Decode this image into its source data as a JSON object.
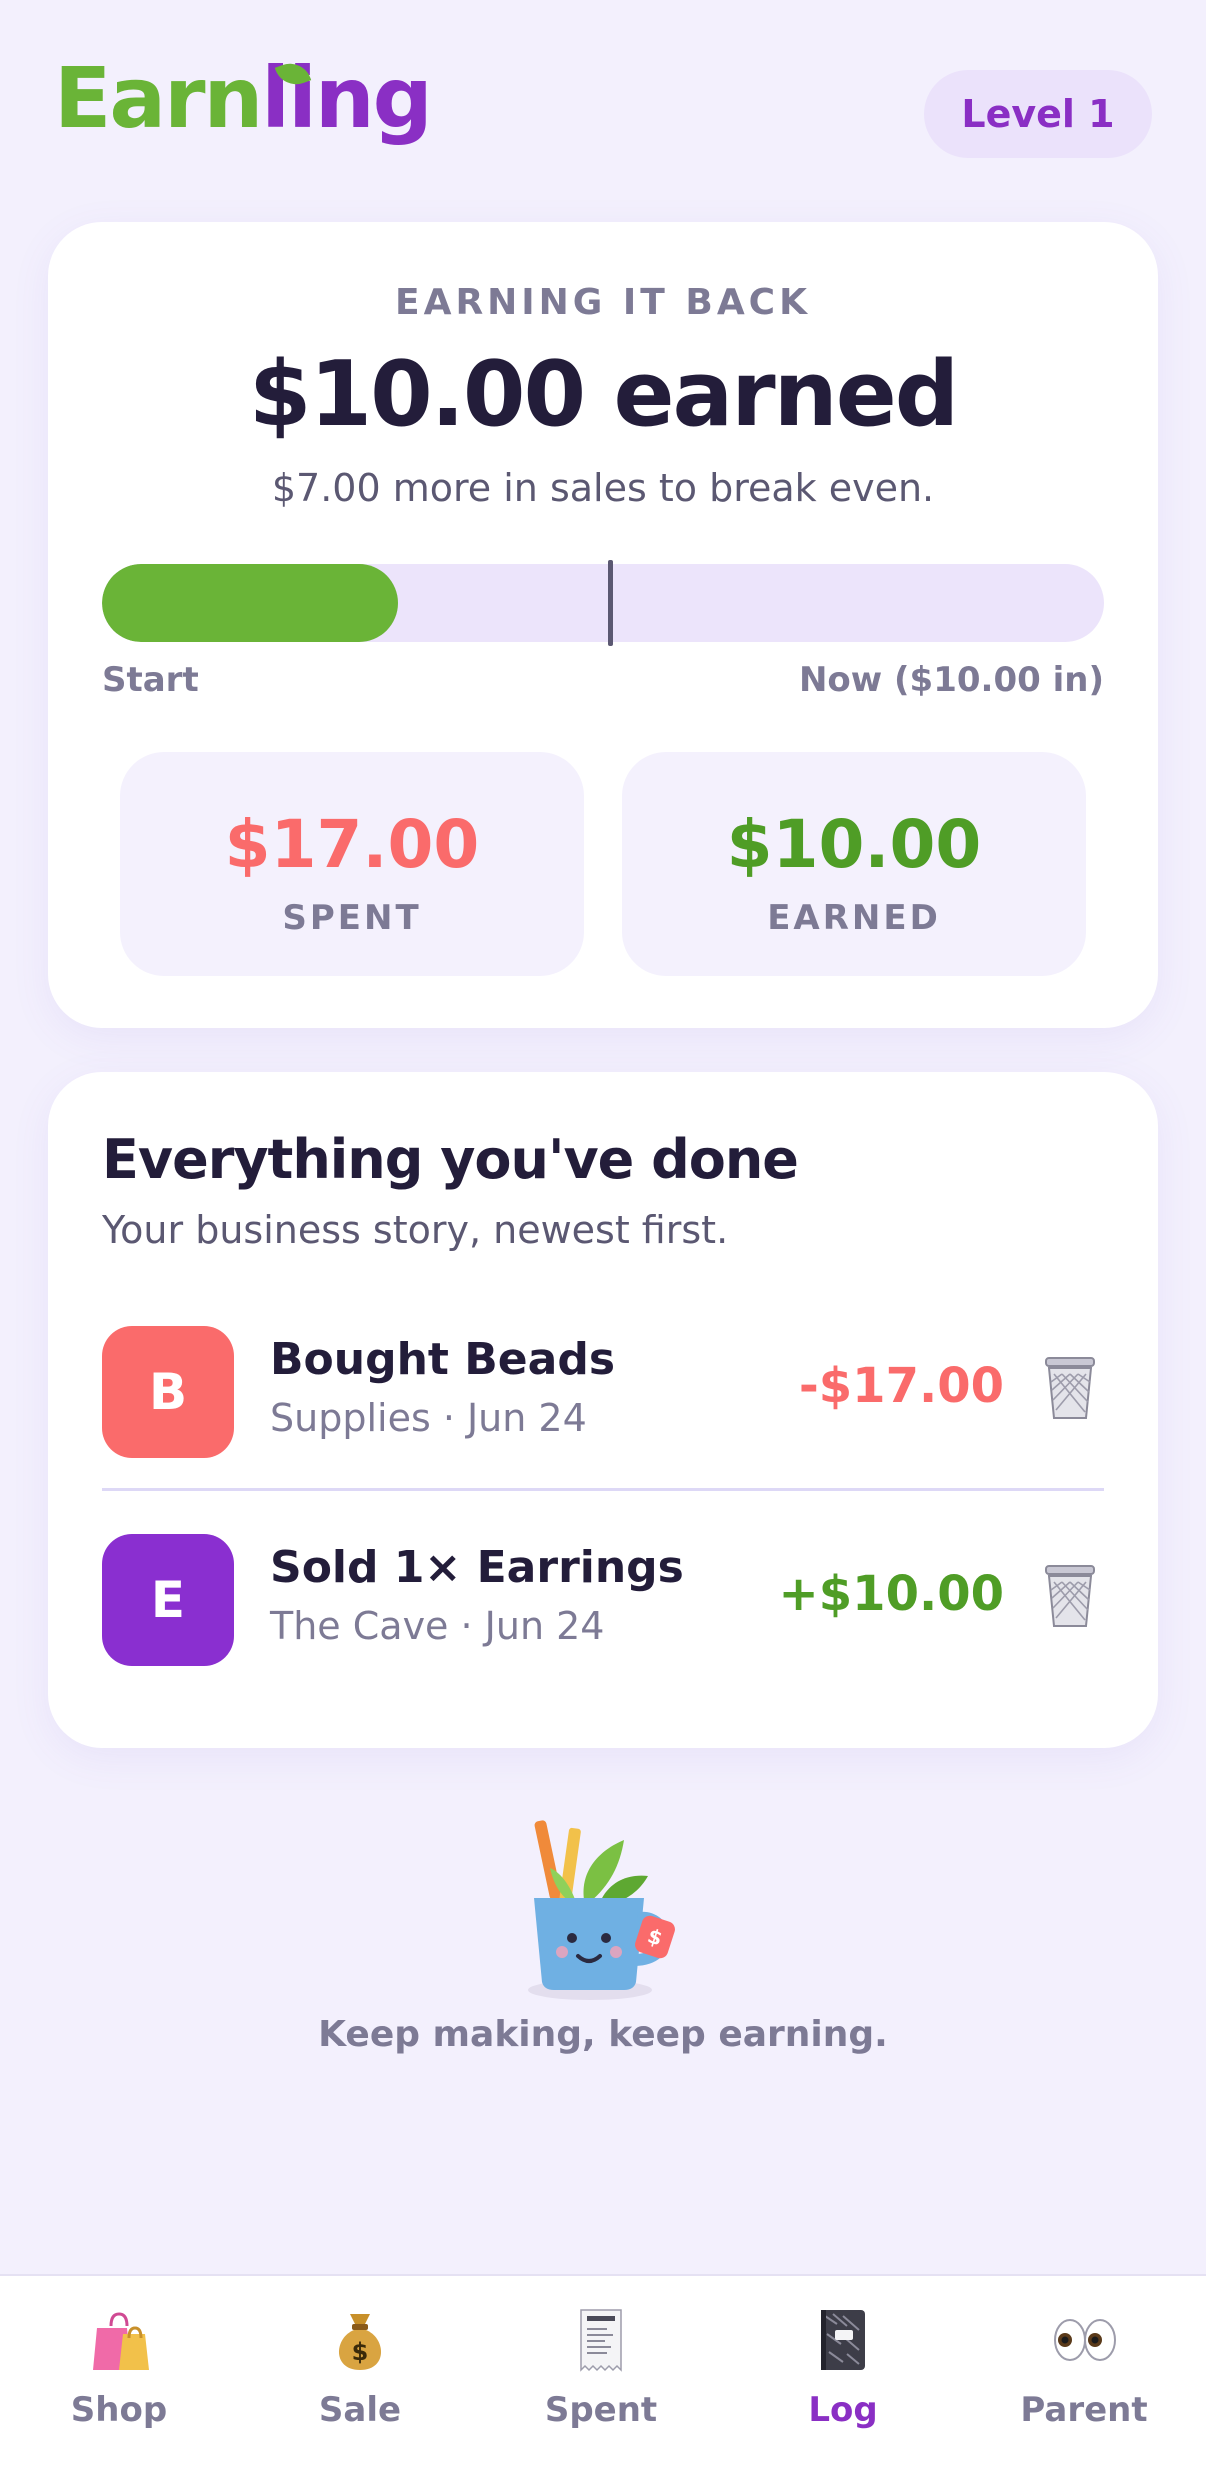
{
  "header": {
    "logo_part1": "Earn",
    "logo_part2": "ling",
    "level_label": "Level 1"
  },
  "summary": {
    "eyebrow": "EARNING IT BACK",
    "headline": "$10.00 earned",
    "note": "$7.00 more in sales to break even.",
    "progress_fraction": 0.295,
    "break_even_fraction": 0.505,
    "progress_start_label": "Start",
    "progress_now_label": "Now ($10.00 in)",
    "spent_value": "$17.00",
    "spent_label": "SPENT",
    "earned_value": "$10.00",
    "earned_label": "EARNED"
  },
  "log": {
    "title": "Everything you've done",
    "subtitle": "Your business story, newest first.",
    "entries": [
      {
        "initial": "B",
        "name": "Bought Beads",
        "meta": "Supplies · Jun 24",
        "amount": "-$17.00"
      },
      {
        "initial": "E",
        "name": "Sold 1× Earrings",
        "meta": "The Cave · Jun 24",
        "amount": "+$10.00"
      }
    ]
  },
  "footer": {
    "message": "Keep making, keep earning."
  },
  "nav": {
    "items": [
      {
        "label": "Shop",
        "icon": "shopping-bags-icon"
      },
      {
        "label": "Sale",
        "icon": "money-bag-icon"
      },
      {
        "label": "Spent",
        "icon": "receipt-icon"
      },
      {
        "label": "Log",
        "icon": "notebook-icon"
      },
      {
        "label": "Parent",
        "icon": "eyes-icon"
      }
    ],
    "active": "Log"
  },
  "colors": {
    "brand_green": "#6ab437",
    "brand_purple": "#8a2fc4",
    "spent_red": "#fa6b6b",
    "earned_green": "#4f9d26"
  }
}
